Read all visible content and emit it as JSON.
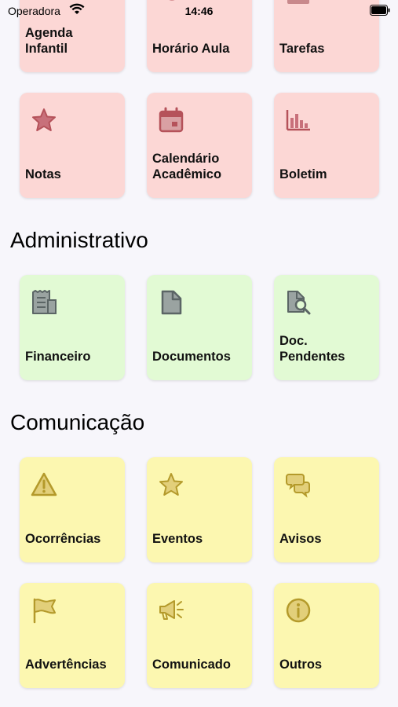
{
  "status_bar": {
    "carrier": "Operadora",
    "time": "14:46"
  },
  "sections": {
    "administrativo": "Administrativo",
    "comunicacao": "Comunicação"
  },
  "cards": {
    "agenda_infantil": "Agenda\nInfantil",
    "horario_aula": "Horário Aula",
    "tarefas": "Tarefas",
    "notas": "Notas",
    "calendario_academico": "Calendário\nAcadêmico",
    "boletim": "Boletim",
    "financeiro": "Financeiro",
    "documentos": "Documentos",
    "doc_pendentes": "Doc.\nPendentes",
    "ocorrencias": "Ocorrências",
    "eventos": "Eventos",
    "avisos": "Avisos",
    "advertencias": "Advertências",
    "comunicado": "Comunicado",
    "outros": "Outros"
  },
  "icons": {
    "academic_color": "#b5525a",
    "admin_color": "#5b6565",
    "comm_color": "#b49a2b"
  },
  "colors": {
    "academic_bg": "#fcd7d5",
    "admin_bg": "#e2fad4",
    "comm_bg": "#fcf7b0"
  }
}
